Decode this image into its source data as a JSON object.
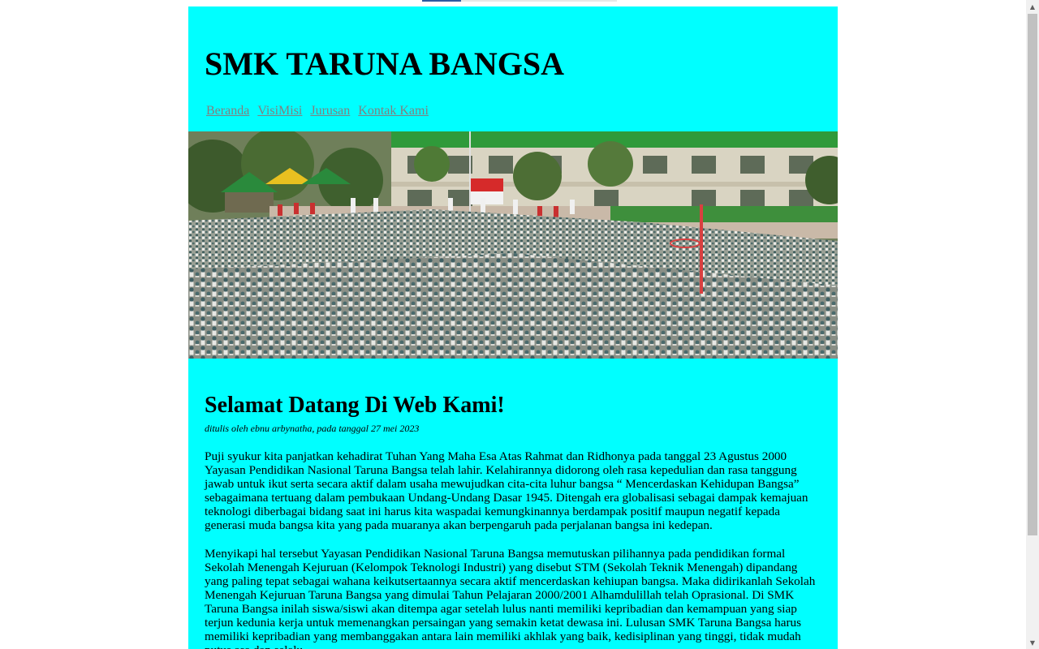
{
  "header": {
    "site_title": "SMK TARUNA BANGSA"
  },
  "nav": {
    "items": [
      "Beranda",
      "VisiMisi",
      "Jurusan",
      "Kontak Kami"
    ]
  },
  "hero": {
    "icon": "school-assembly-photo"
  },
  "article": {
    "title": "Selamat Datang Di Web Kami!",
    "byline": "ditulis oleh ebnu arbynatha, pada tanggal 27 mei 2023",
    "paragraphs": [
      "Puji syukur kita panjatkan kehadirat Tuhan Yang Maha Esa Atas Rahmat dan Ridhonya pada tanggal 23 Agustus 2000 Yayasan Pendidikan Nasional Taruna Bangsa telah lahir. Kelahirannya didorong oleh rasa kepedulian dan rasa tanggung jawab untuk ikut serta secara aktif dalam usaha mewujudkan cita-cita luhur bangsa “ Mencerdaskan Kehidupan Bangsa” sebagaimana tertuang dalam pembukaan Undang-Undang Dasar 1945. Ditengah era globalisasi sebagai dampak kemajuan teknologi diberbagai bidang saat ini harus kita waspadai kemungkinannya berdampak positif maupun negatif kepada generasi muda bangsa kita yang pada muaranya akan berpengaruh pada perjalanan bangsa ini kedepan.",
      "Menyikapi hal tersebut Yayasan Pendidikan Nasional Taruna Bangsa memutuskan pilihannya pada pendidikan formal Sekolah Menengah Kejuruan (Kelompok Teknologi Industri) yang disebut STM (Sekolah Teknik Menengah) dipandang yang paling tepat sebagai wahana keikutsertaannya secara aktif mencerdaskan kehiupan bangsa. Maka didirikanlah Sekolah Menengah Kejuruan Taruna Bangsa yang dimulai Tahun Pelajaran 2000/2001 Alhamdulillah telah Oprasional. Di SMK Taruna Bangsa inilah siswa/siswi akan ditempa agar setelah lulus nanti memiliki kepribadian dan kemampuan yang siap terjun kedunia kerja untuk memenangkan persaingan yang semakin ketat dewasa ini. Lulusan SMK Taruna Bangsa harus memiliki kepribadian yang membanggakan antara lain memiliki akhlak yang baik, kedisiplinan yang tinggi, tidak mudah putus asa dan selalu"
    ]
  },
  "colors": {
    "page_bg": "#00ffff",
    "nav_link": "#808080"
  }
}
